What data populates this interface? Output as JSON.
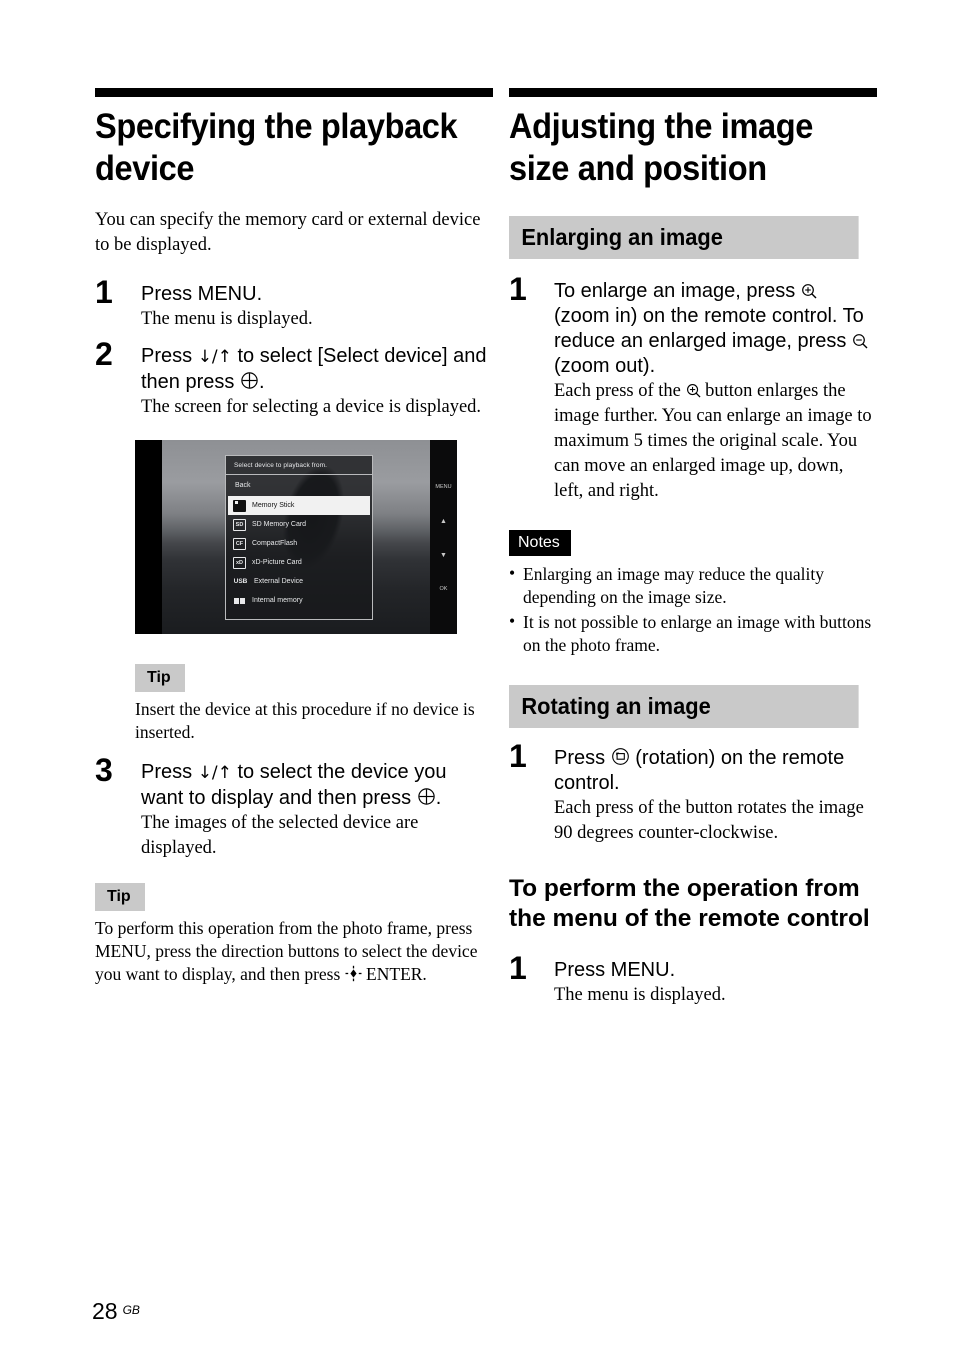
{
  "left_column": {
    "chapter_title": "Specifying the playback device",
    "intro": "You can specify the memory card or external device to be displayed.",
    "steps": [
      {
        "num": "1",
        "title": "Press MENU.",
        "body": "The menu is displayed."
      },
      {
        "num": "2",
        "title_part1": "Press ",
        "title_arrows": "↓/↑",
        "title_part2": " to select [Select device] and then press ",
        "title_part3": ".",
        "body": "The screen for selecting a device is displayed."
      },
      {
        "num": "3",
        "title_part1": "Press ",
        "title_arrows": "↓/↑",
        "title_part2": " to select the device you want to display and then press ",
        "title_part3": ".",
        "body": "The images of the selected device are displayed."
      }
    ],
    "tips": [
      {
        "label": "Tip",
        "body": "Insert the device at this procedure if no device is inserted."
      },
      {
        "label": "Tip",
        "body_part1": "To perform this operation from the photo frame, press MENU, press the direction buttons to select the device you want to display, and then press ",
        "body_part2": " ENTER."
      }
    ],
    "screenshot": {
      "osd_title": "Select device to playback from.",
      "back_label": "Back",
      "items": [
        {
          "icon": "memory-stick-icon",
          "label": "Memory Stick",
          "selected": true
        },
        {
          "icon": "sd-card-icon",
          "label": "SD Memory Card",
          "selected": false
        },
        {
          "icon": "compactflash-icon",
          "label": "CompactFlash",
          "selected": false
        },
        {
          "icon": "xd-card-icon",
          "label": "xD-Picture Card",
          "selected": false
        },
        {
          "icon": "usb-icon",
          "label": "External Device",
          "selected": false
        },
        {
          "icon": "internal-memory-icon",
          "label": "Internal memory",
          "selected": false
        }
      ],
      "icon_texts": {
        "sd": "SD",
        "cf": "CF",
        "xd": "xD",
        "usb": "USB"
      },
      "side_buttons": {
        "menu": "MENU",
        "up": "▲",
        "down": "▼",
        "ok": "OK"
      }
    }
  },
  "right_column": {
    "chapter_title": "Adjusting the image size and position",
    "section_enlarging": {
      "banner": "Enlarging an image",
      "step": {
        "num": "1",
        "title_part1": "To enlarge an image, press ",
        "title_part2": " (zoom in) on the remote control. To reduce an enlarged image, press ",
        "title_part3": " (zoom out).",
        "body_part1": "Each press of the ",
        "body_part2": " button enlarges the image further. You can enlarge an image to maximum 5 times the original scale. You can move an enlarged image up, down, left, and right."
      },
      "notes": {
        "label": "Notes",
        "items": [
          "Enlarging an image may reduce the quality depending on the image size.",
          "It is not possible to enlarge an image with buttons on the photo frame."
        ]
      }
    },
    "section_rotating": {
      "banner": "Rotating an image",
      "step": {
        "num": "1",
        "title_part1": "Press ",
        "title_part2": " (rotation) on the remote control.",
        "body": "Each press of the button rotates the image 90 degrees counter-clockwise."
      },
      "subhead": "To perform the operation from the menu of the remote control",
      "step_menu": {
        "num": "1",
        "title": "Press MENU.",
        "body": "The menu is displayed."
      }
    }
  },
  "footer": {
    "page_number": "28",
    "region": "GB"
  },
  "colors": {
    "banner_gray": "#c9c9c9",
    "badge_black": "#000000",
    "text": "#000000",
    "page_bg": "#ffffff"
  }
}
